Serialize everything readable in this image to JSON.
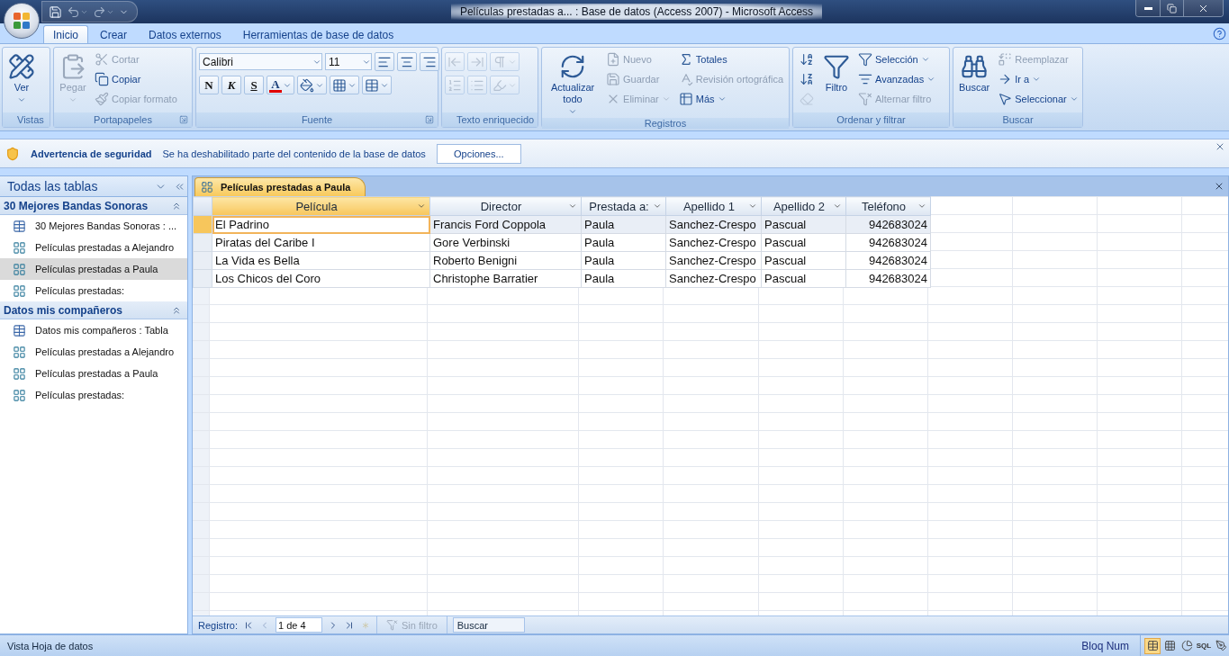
{
  "window": {
    "title": "Películas prestadas a... : Base de datos (Access 2007)  -  Microsoft Access"
  },
  "ribbon": {
    "tabs": [
      {
        "label": "Inicio",
        "selected": true
      },
      {
        "label": "Crear",
        "selected": false
      },
      {
        "label": "Datos externos",
        "selected": false
      },
      {
        "label": "Herramientas de base de datos",
        "selected": false
      }
    ],
    "groups": [
      {
        "label": "Vistas",
        "launcher": false,
        "items": [
          {
            "kind": "large",
            "label": "Ver",
            "dropdown": true,
            "disabled": false
          }
        ]
      },
      {
        "label": "Portapapeles",
        "launcher": true,
        "items": [
          {
            "kind": "large",
            "label": "Pegar",
            "dropdown": true,
            "disabled": true
          },
          {
            "kind": "small",
            "label": "Cortar",
            "dropdown": false,
            "disabled": true
          },
          {
            "kind": "small",
            "label": "Copiar",
            "dropdown": false,
            "disabled": false
          },
          {
            "kind": "small",
            "label": "Copiar formato",
            "dropdown": false,
            "disabled": true
          }
        ]
      },
      {
        "label": "Fuente",
        "launcher": true,
        "rows": [
          [
            {
              "kind": "combo",
              "value": "Calibri",
              "dropdown": true,
              "disabled": false
            },
            {
              "kind": "combo",
              "value": "11",
              "dropdown": true,
              "disabled": false
            },
            {
              "kind": "icon",
              "dropdown": false,
              "disabled": false
            },
            {
              "kind": "icon",
              "dropdown": false,
              "disabled": false
            },
            {
              "kind": "icon",
              "dropdown": false,
              "disabled": false
            }
          ],
          [
            {
              "kind": "icon",
              "label": "N",
              "dropdown": false,
              "disabled": false
            },
            {
              "kind": "icon",
              "label": "K",
              "dropdown": false,
              "disabled": false
            },
            {
              "kind": "icon",
              "label": "S",
              "dropdown": false,
              "disabled": false
            },
            {
              "kind": "icon",
              "label": "A",
              "dropdown": true,
              "disabled": false
            },
            {
              "kind": "icon",
              "dropdown": true,
              "disabled": false
            },
            {
              "kind": "icon",
              "dropdown": true,
              "disabled": false
            },
            {
              "kind": "icon",
              "dropdown": true,
              "disabled": false
            }
          ]
        ]
      },
      {
        "label": "Texto enriquecido",
        "launcher": false,
        "rows": [
          [
            {
              "kind": "icon",
              "dropdown": false,
              "disabled": true
            },
            {
              "kind": "icon",
              "dropdown": false,
              "disabled": true
            },
            {
              "kind": "icon",
              "dropdown": true,
              "disabled": true
            }
          ],
          [
            {
              "kind": "icon",
              "dropdown": false,
              "disabled": true
            },
            {
              "kind": "icon",
              "dropdown": false,
              "disabled": true
            },
            {
              "kind": "icon",
              "dropdown": true,
              "disabled": true
            }
          ]
        ]
      },
      {
        "label": "Registros",
        "launcher": false,
        "items": [
          {
            "kind": "large",
            "label": "Actualizar todo",
            "dropdown": true,
            "disabled": false
          },
          {
            "kind": "small",
            "label": "Nuevo",
            "dropdown": false,
            "disabled": true
          },
          {
            "kind": "small",
            "label": "Guardar",
            "dropdown": false,
            "disabled": true
          },
          {
            "kind": "small",
            "label": "Eliminar",
            "dropdown": true,
            "disabled": true
          },
          {
            "kind": "small",
            "label": "Totales",
            "dropdown": false,
            "disabled": false
          },
          {
            "kind": "small",
            "label": "Revisión ortográfica",
            "dropdown": false,
            "disabled": true
          },
          {
            "kind": "small",
            "label": "Más",
            "dropdown": true,
            "disabled": false
          }
        ]
      },
      {
        "label": "Ordenar y filtrar",
        "launcher": false,
        "items": [
          {
            "kind": "icon",
            "dropdown": false,
            "disabled": false
          },
          {
            "kind": "icon",
            "dropdown": false,
            "disabled": false
          },
          {
            "kind": "icon",
            "dropdown": false,
            "disabled": true
          },
          {
            "kind": "large",
            "label": "Filtro",
            "dropdown": false,
            "disabled": false
          },
          {
            "kind": "small",
            "label": "Selección",
            "dropdown": true,
            "disabled": false
          },
          {
            "kind": "small",
            "label": "Avanzadas",
            "dropdown": true,
            "disabled": false
          },
          {
            "kind": "small",
            "label": "Alternar filtro",
            "dropdown": false,
            "disabled": true
          }
        ]
      },
      {
        "label": "Buscar",
        "launcher": false,
        "items": [
          {
            "kind": "large",
            "label": "Buscar",
            "dropdown": false,
            "disabled": false
          },
          {
            "kind": "small",
            "label": "Reemplazar",
            "dropdown": false,
            "disabled": true
          },
          {
            "kind": "small",
            "label": "Ir a",
            "dropdown": true,
            "disabled": false
          },
          {
            "kind": "small",
            "label": "Seleccionar",
            "dropdown": true,
            "disabled": false
          }
        ]
      }
    ]
  },
  "security_bar": {
    "title": "Advertencia de seguridad",
    "message": "Se ha deshabilitado parte del contenido de la base de datos",
    "button": "Opciones..."
  },
  "navigation": {
    "header": "Todas las tablas",
    "sections": [
      {
        "title": "30 Mejores Bandas Sonoras",
        "expanded": true,
        "items": [
          {
            "label": "30 Mejores Bandas Sonoras : ...",
            "kind": "table",
            "selected": false
          },
          {
            "label": "Películas prestadas a Alejandro",
            "kind": "query",
            "selected": false
          },
          {
            "label": "Películas prestadas a Paula",
            "kind": "query",
            "selected": true
          },
          {
            "label": "Películas prestadas:",
            "kind": "query",
            "selected": false
          }
        ]
      },
      {
        "title": "Datos mis compañeros",
        "expanded": true,
        "items": [
          {
            "label": "Datos mis compañeros : Tabla",
            "kind": "table",
            "selected": false
          },
          {
            "label": "Películas prestadas a Alejandro",
            "kind": "query",
            "selected": false
          },
          {
            "label": "Películas prestadas a Paula",
            "kind": "query",
            "selected": false
          },
          {
            "label": "Películas prestadas:",
            "kind": "query",
            "selected": false
          }
        ]
      }
    ]
  },
  "document": {
    "tab": "Películas prestadas a Paula",
    "columns": [
      {
        "label": "Película",
        "kind": "text",
        "selected": true
      },
      {
        "label": "Director",
        "kind": "text",
        "selected": false
      },
      {
        "label": "Prestada a:",
        "kind": "text",
        "selected": false
      },
      {
        "label": "Apellido 1",
        "kind": "text",
        "selected": false
      },
      {
        "label": "Apellido 2",
        "kind": "text",
        "selected": false
      },
      {
        "label": "Teléfono",
        "kind": "number",
        "selected": false
      }
    ],
    "rows": [
      {
        "selected": true,
        "cells": [
          "El Padrino",
          "Francis Ford Coppola",
          "Paula",
          "Sanchez-Crespo",
          "Pascual",
          "942683024"
        ]
      },
      {
        "selected": false,
        "cells": [
          "Piratas del Caribe I",
          "Gore Verbinski",
          "Paula",
          "Sanchez-Crespo",
          "Pascual",
          "942683024"
        ]
      },
      {
        "selected": false,
        "cells": [
          "La Vida es Bella",
          "Roberto Benigni",
          "Paula",
          "Sanchez-Crespo",
          "Pascual",
          "942683024"
        ]
      },
      {
        "selected": false,
        "cells": [
          "Los Chicos del Coro",
          "Christophe Barratier",
          "Paula",
          "Sanchez-Crespo",
          "Pascual",
          "942683024"
        ]
      }
    ],
    "record_nav": {
      "label": "Registro:",
      "position": "1 de 4",
      "filter": "Sin filtro",
      "filter_disabled": true,
      "search_placeholder": "Buscar"
    }
  },
  "status_bar": {
    "text": "Vista Hoja de datos",
    "indicator": "Bloq Num",
    "views": [
      {
        "selected": true
      },
      {
        "selected": false
      },
      {
        "selected": false
      },
      {
        "label": "SQL",
        "selected": false
      },
      {
        "selected": false
      }
    ]
  }
}
